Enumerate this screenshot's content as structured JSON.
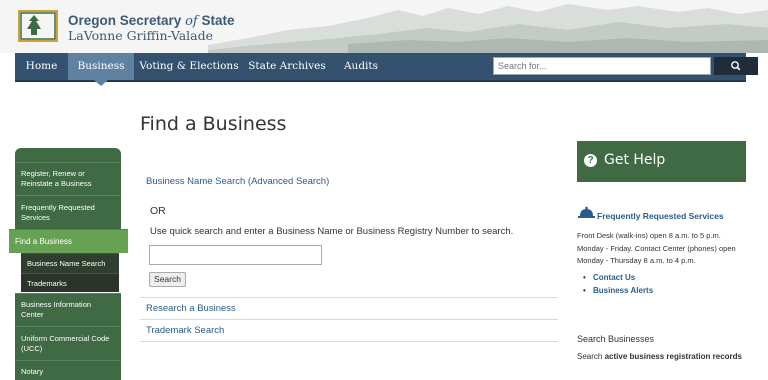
{
  "header": {
    "brand_title_main": "Oregon Secretary",
    "brand_title_of": "of",
    "brand_title_end": "State",
    "brand_subtitle": "LaVonne Griffin-Valade"
  },
  "nav": {
    "items": [
      {
        "label": "Home"
      },
      {
        "label": "Business"
      },
      {
        "label": "Voting & Elections"
      },
      {
        "label": "State Archives"
      },
      {
        "label": "Audits"
      }
    ],
    "active": "Business",
    "search_placeholder": "Search for...",
    "search_icon": "search-icon"
  },
  "page": {
    "title": "Find a Business"
  },
  "sidebar": {
    "items": [
      {
        "label": "Register, Renew or Reinstate a Business"
      },
      {
        "label": "Frequently Requested Services"
      },
      {
        "label": "Find a Business"
      },
      {
        "label": "Business Name Search"
      },
      {
        "label": "Trademarks"
      },
      {
        "label": "Business Information Center"
      },
      {
        "label": "Uniform Commercial Code (UCC)"
      },
      {
        "label": "Notary"
      }
    ],
    "active": "Find a Business"
  },
  "main": {
    "advanced_link": "Business Name Search (Advanced Search)",
    "or_label": "OR",
    "instructions": "Use quick search and enter a Business Name or Business Registry Number to search.",
    "input_value": "",
    "search_button": "Search",
    "links": [
      {
        "label": "Research a Business"
      },
      {
        "label": "Trademark Search"
      }
    ]
  },
  "right": {
    "get_help": "Get Help",
    "get_help_icon": "question-icon",
    "faq_icon": "bell-icon",
    "faq_link": "Frequently Requested Services",
    "hours_lines": [
      "Front Desk (walk-ins) open 8 a.m. to 5 p.m.",
      "Monday - Friday. Contact Center (phones) open",
      "Monday - Thursday 8 a.m. to 4 p.m."
    ],
    "links": [
      {
        "label": "Contact Us"
      },
      {
        "label": "Business Alerts"
      }
    ],
    "search_heading": "Search Businesses",
    "search_text_prefix": "Search",
    "search_text_bold": "active business registration records"
  },
  "colors": {
    "nav_bg": "#34526f",
    "nav_active": "#5f82a3",
    "sidebar_green": "#3f6a44",
    "sidebar_active": "#67a154",
    "link_blue": "#2b5c8a"
  }
}
